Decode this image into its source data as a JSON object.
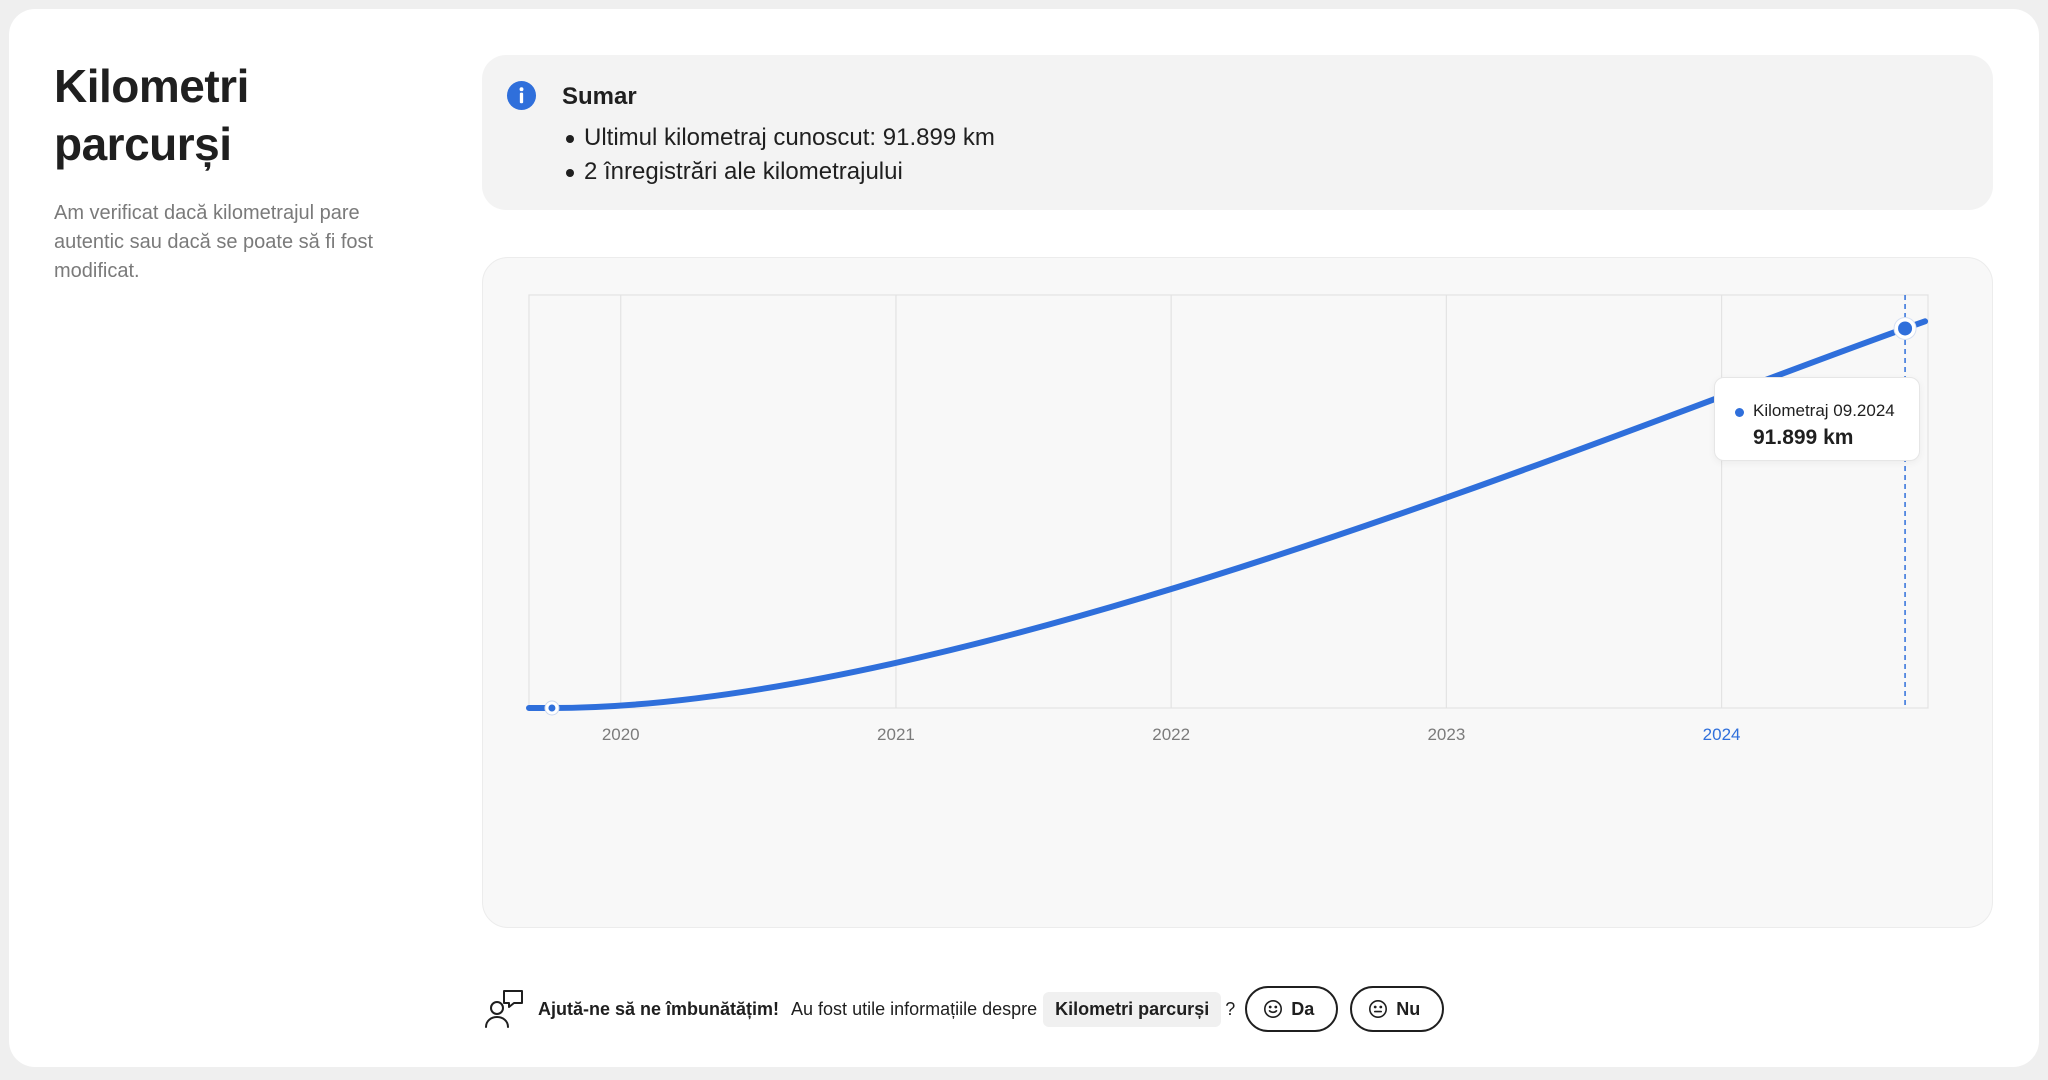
{
  "left": {
    "title_line1": "Kilometri",
    "title_line2": "parcurși",
    "description": "Am verificat dacă kilometrajul pare autentic sau dacă se poate să fi fost modificat."
  },
  "summary": {
    "icon": "info-icon",
    "title": "Sumar",
    "items": [
      "Ultimul kilometraj cunoscut: 91.899 km",
      "2 înregistrări ale kilometrajului"
    ]
  },
  "chart_data": {
    "type": "line",
    "x_axis_type": "date",
    "xlim": [
      "2019-09",
      "2024-10"
    ],
    "ylim": [
      0,
      100000
    ],
    "x_ticks": [
      {
        "label": "2020",
        "date": "2020-01"
      },
      {
        "label": "2021",
        "date": "2021-01"
      },
      {
        "label": "2022",
        "date": "2022-01"
      },
      {
        "label": "2023",
        "date": "2023-01"
      },
      {
        "label": "2024",
        "date": "2024-01",
        "highlighted": true
      }
    ],
    "grid": "vertical",
    "series": [
      {
        "points": [
          {
            "date": "2019-10",
            "km": 0
          },
          {
            "date": "2024-09",
            "km": 91899
          }
        ]
      }
    ],
    "tooltip": {
      "label": "Kilometraj 09.2024",
      "value": "91.899 km",
      "date": "2024-09"
    },
    "colors": {
      "line": "#2f6fdb",
      "highlight_tick": "#2f6fdb",
      "grid": "#e3e3e3"
    }
  },
  "feedback": {
    "icon": "feedback-person-icon",
    "strong": "Ajută-ne să ne îmbunătățim!",
    "text": "Au fost utile informațiile despre",
    "tag": "Kilometri parcurși",
    "question_mark": "?",
    "yes_label": "Da",
    "no_label": "Nu"
  }
}
